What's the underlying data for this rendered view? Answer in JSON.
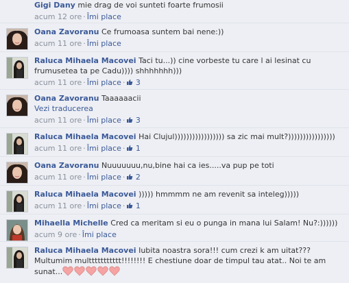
{
  "comments": [
    {
      "author": "Gigi Dany",
      "text": "mie drag de voi sunteti foarte frumosii",
      "time": "acum 12 ore",
      "like_label": "Îmi place",
      "likes": "",
      "avatar": "none"
    },
    {
      "author": "Oana Zavoranu",
      "text": "Ce frumoasa suntem bai nene:))",
      "time": "acum 11 ore",
      "like_label": "Îmi place",
      "likes": "",
      "avatar": "oana"
    },
    {
      "author": "Raluca Mihaela Macovei",
      "text": "Taci tu...)) cine vorbeste tu care l ai lesinat cu frumusetea ta pe Cadu)))) shhhhhhh)))",
      "time": "acum 11 ore",
      "like_label": "Îmi place",
      "likes": "3",
      "avatar": "raluca"
    },
    {
      "author": "Oana Zavoranu",
      "text": "Taaaaaacii",
      "translate": "Vezi traducerea",
      "time": "acum 11 ore",
      "like_label": "Îmi place",
      "likes": "3",
      "avatar": "oana"
    },
    {
      "author": "Raluca Mihaela Macovei",
      "text": "Hai Clujul))))))))))))))))) sa zic mai mult?))))))))))))))))",
      "time": "acum 11 ore",
      "like_label": "Îmi place",
      "likes": "1",
      "avatar": "raluca"
    },
    {
      "author": "Oana Zavoranu",
      "text": "Nuuuuuuu,nu,bine hai ca ies.....va pup pe toti",
      "time": "acum 11 ore",
      "like_label": "Îmi place",
      "likes": "2",
      "avatar": "oana"
    },
    {
      "author": "Raluca Mihaela Macovei",
      "text": "))))) hmmmm ne am revenit sa inteleg)))))",
      "time": "acum 11 ore",
      "like_label": "Îmi place",
      "likes": "1",
      "avatar": "raluca"
    },
    {
      "author": "Mihaella Michelle",
      "text": "Cred ca meritam si eu o punga in mana lui Salam! Nu?:))))))",
      "time": "acum 9 ore",
      "like_label": "Îmi place",
      "likes": "",
      "avatar": "mihaella"
    },
    {
      "author": "Raluca Mihaela Macovei",
      "text": "Iubita noastra sora!!! cum crezi k am uitat??? Multumim multtttttttttt!!!!!!!! E chestiune doar de timpul tau atat.. Noi te am sunat...",
      "time": "",
      "like_label": "",
      "likes": "",
      "avatar": "raluca",
      "hearts": 5
    }
  ],
  "colors": {
    "link": "#3b5998",
    "meta": "#898f9c",
    "background": "#edeff4",
    "heart": "#f5a3a3"
  }
}
